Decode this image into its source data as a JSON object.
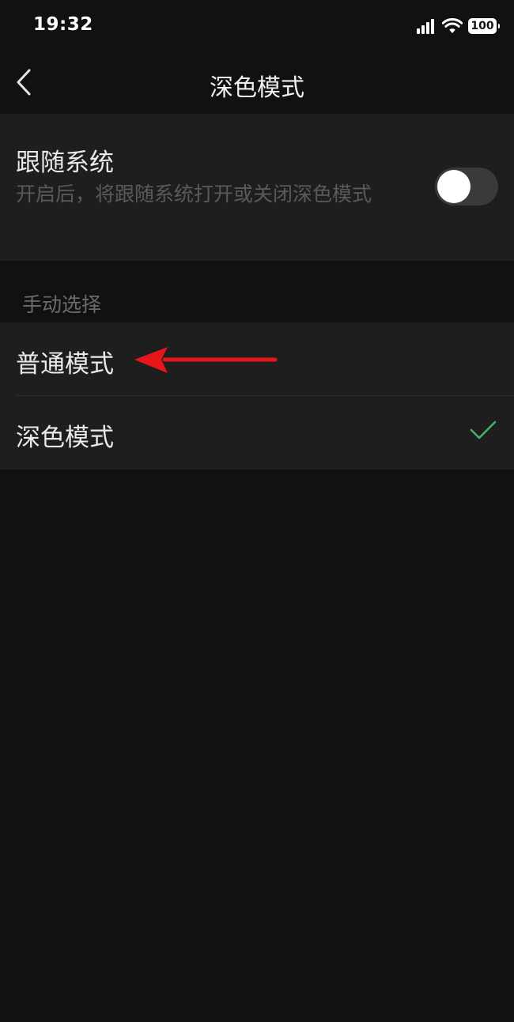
{
  "status_bar": {
    "time": "19:32",
    "battery": "100",
    "icons": [
      "signal-icon",
      "wifi-icon",
      "battery-icon"
    ]
  },
  "nav": {
    "title": "深色模式",
    "back_icon": "chevron-left-icon"
  },
  "follow_system": {
    "title": "跟随系统",
    "description": "开启后，将跟随系统打开或关闭深色模式",
    "toggle_on": false
  },
  "manual_section": {
    "header": "手动选择",
    "options": [
      {
        "label": "普通模式",
        "selected": false
      },
      {
        "label": "深色模式",
        "selected": true
      }
    ]
  },
  "colors": {
    "background": "#111111",
    "card": "#1e1e1e",
    "check_green": "#4caf6a",
    "annotation_red": "#e8161b"
  }
}
